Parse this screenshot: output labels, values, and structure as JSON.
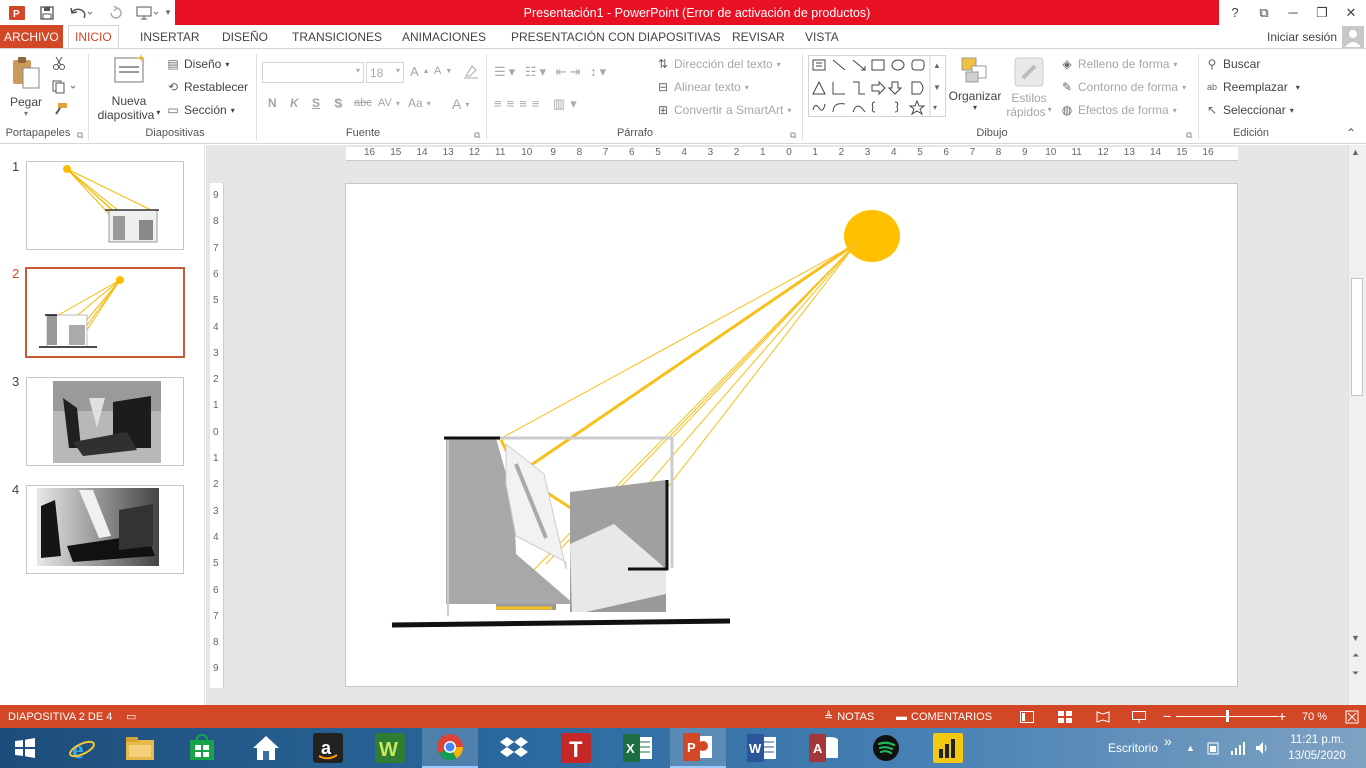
{
  "window": {
    "title": "Presentación1 -  PowerPoint (Error de activación de productos)",
    "help": "?",
    "restore_ribbon": "⧉",
    "minimize": "─",
    "maximize": "❐",
    "close": "✕"
  },
  "qat": {
    "icons": [
      "powerpoint-logo-icon",
      "save-icon",
      "undo-icon",
      "redo-icon",
      "present-icon",
      "customize-icon"
    ]
  },
  "tabs": [
    "ARCHIVO",
    "INICIO",
    "INSERTAR",
    "DISEÑO",
    "TRANSICIONES",
    "ANIMACIONES",
    "PRESENTACIÓN CON DIAPOSITIVAS",
    "REVISAR",
    "VISTA"
  ],
  "active_tab": "INICIO",
  "signin": "Iniciar sesión",
  "ribbon": {
    "clipboard": {
      "paste": "Pegar",
      "label": "Portapapeles"
    },
    "slides": {
      "new_slide_1": "Nueva",
      "new_slide_2": "diapositiva",
      "layout": "Diseño",
      "reset": "Restablecer",
      "section": "Sección",
      "label": "Diapositivas"
    },
    "font": {
      "font_name": "",
      "font_size": "18",
      "label": "Fuente",
      "bold": "N",
      "italic": "K",
      "underline": "S",
      "shadow": "S",
      "strike": "abc",
      "spacing": "AV",
      "case": "Aa",
      "color": "A",
      "grow": "A",
      "shrink": "A"
    },
    "paragraph": {
      "text_direction": "Dirección del texto",
      "align_text": "Alinear texto",
      "smartart": "Convertir a SmartArt",
      "label": "Párrafo"
    },
    "drawing": {
      "arrange": "Organizar",
      "quick_styles_1": "Estilos",
      "quick_styles_2": "rápidos",
      "fill": "Relleno de forma",
      "outline": "Contorno de forma",
      "effects": "Efectos de forma",
      "label": "Dibujo"
    },
    "editing": {
      "find": "Buscar",
      "replace": "Reemplazar",
      "select": "Seleccionar",
      "label": "Edición"
    }
  },
  "thumbnails": [
    {
      "num": "1"
    },
    {
      "num": "2"
    },
    {
      "num": "3"
    },
    {
      "num": "4"
    }
  ],
  "selected_slide": 2,
  "ruler": {
    "h": [
      "16",
      "15",
      "14",
      "13",
      "12",
      "11",
      "10",
      "9",
      "8",
      "7",
      "6",
      "5",
      "4",
      "3",
      "2",
      "1",
      "0",
      "1",
      "2",
      "3",
      "4",
      "5",
      "6",
      "7",
      "8",
      "9",
      "10",
      "11",
      "12",
      "13",
      "14",
      "15",
      "16"
    ],
    "v": [
      "9",
      "8",
      "7",
      "6",
      "5",
      "4",
      "3",
      "2",
      "1",
      "0",
      "1",
      "2",
      "3",
      "4",
      "5",
      "6",
      "7",
      "8",
      "9"
    ]
  },
  "status": {
    "slide_info": "DIAPOSITIVA 2 DE 4",
    "notes": "NOTAS",
    "comments": "COMENTARIOS",
    "zoom_minus": "−",
    "zoom_plus": "+",
    "zoom": "70 %",
    "zoom_fraction": 0.5
  },
  "taskbar": {
    "desktop": "Escritorio",
    "chevron": "»",
    "time": "11:21 p.m.",
    "date": "13/05/2020",
    "apps": [
      "start",
      "internet-explorer",
      "file-explorer",
      "store",
      "home",
      "amazon",
      "wunderlist",
      "chrome",
      "dropbox",
      "t-app",
      "excel",
      "powerpoint",
      "word",
      "access",
      "spotify",
      "power-bi"
    ]
  },
  "colors": {
    "accent": "#d24726",
    "title_red": "#e81123",
    "sun": "#ffc000"
  }
}
